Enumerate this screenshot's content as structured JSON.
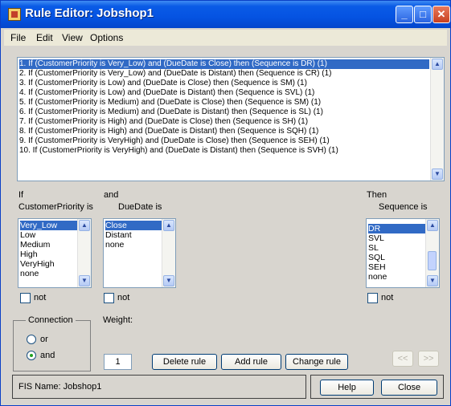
{
  "window": {
    "title": "Rule Editor: Jobshop1",
    "minimize": "_",
    "maximize": "□",
    "close": "✕"
  },
  "menu": [
    "File",
    "Edit",
    "View",
    "Options"
  ],
  "rules": [
    "1. If (CustomerPriority is Very_Low) and (DueDate is Close) then (Sequence is DR) (1)",
    "2. If (CustomerPriority is Very_Low) and (DueDate is Distant) then (Sequence is CR) (1)",
    "3. If (CustomerPriority is Low) and (DueDate is Close) then (Sequence is SM) (1)",
    "4. If (CustomerPriority is Low) and (DueDate is Distant) then (Sequence is SVL) (1)",
    "5. If (CustomerPriority is Medium) and (DueDate is Close) then (Sequence is SM) (1)",
    "6. If (CustomerPriority is Medium) and (DueDate is Distant) then (Sequence is SL) (1)",
    "7. If (CustomerPriority is High) and (DueDate is Close) then (Sequence is SH) (1)",
    "8. If (CustomerPriority is High) and (DueDate is Distant) then (Sequence is SQH) (1)",
    "9. If (CustomerPriority is VeryHigh) and (DueDate is Close) then (Sequence is SEH) (1)",
    "10. If (CustomerPriority is VeryHigh) and (DueDate is Distant) then (Sequence is SVH) (1)"
  ],
  "if_label": "If",
  "and_label": "and",
  "then_label": "Then",
  "input1": {
    "label": "CustomerPriority is",
    "items": [
      "Very_Low",
      "Low",
      "Medium",
      "High",
      "VeryHigh",
      "none"
    ],
    "not_label": "not"
  },
  "input2": {
    "label": "DueDate is",
    "items": [
      "Close",
      "Distant",
      "none"
    ],
    "not_label": "not"
  },
  "output": {
    "label": "Sequence is",
    "items": [
      "DR",
      "SVL",
      "SL",
      "SQL",
      "SEH",
      "none"
    ],
    "not_label": "not"
  },
  "connection": {
    "label": "Connection",
    "or_label": "or",
    "and_label": "and",
    "selected": "and"
  },
  "weight": {
    "label": "Weight:",
    "value": "1"
  },
  "buttons": {
    "delete": "Delete rule",
    "add": "Add rule",
    "change": "Change rule",
    "prev": "<<",
    "next": ">>",
    "help": "Help",
    "close": "Close"
  },
  "status": "FIS Name: Jobshop1"
}
